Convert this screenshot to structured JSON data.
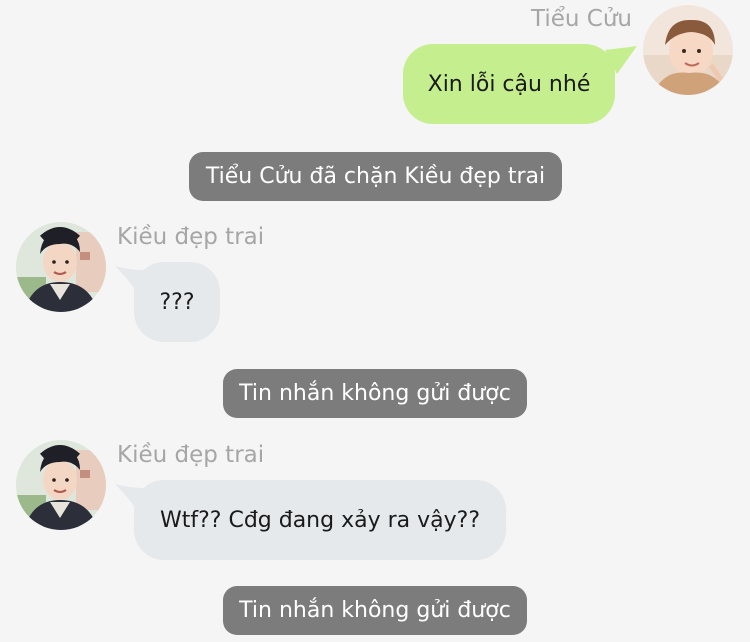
{
  "conversation": {
    "messages": [
      {
        "sender": "Tiểu Cửu",
        "side": "right",
        "text": "Xin lỗi cậu nhé"
      },
      {
        "system": "Tiểu Cửu đã chặn Kiều đẹp trai"
      },
      {
        "sender": "Kiều đẹp trai",
        "side": "left",
        "text": "???"
      },
      {
        "system": "Tin nhắn không gửi được"
      },
      {
        "sender": "Kiều đẹp trai",
        "side": "left",
        "text": "Wtf?? Cđg đang xảy ra vậy??"
      },
      {
        "system": "Tin nhắn không gửi được"
      }
    ]
  },
  "colors": {
    "background": "#f5f5f5",
    "outgoing_bubble": "#c5ee8e",
    "incoming_bubble": "#e6e9ec",
    "system_pill": "#7c7c7c",
    "sender_name": "#a6a6a6"
  },
  "icons": {
    "avatar_right": "avatar-photo-icon",
    "avatar_left": "avatar-photo-icon"
  }
}
